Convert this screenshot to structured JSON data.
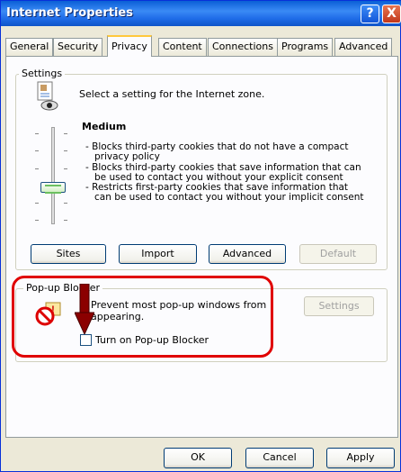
{
  "window": {
    "title": "Internet Properties"
  },
  "title_buttons": {
    "help": "?",
    "close": "X"
  },
  "tabs": [
    "General",
    "Security",
    "Privacy",
    "Content",
    "Connections",
    "Programs",
    "Advanced"
  ],
  "active_tab": "Privacy",
  "settings": {
    "group_label": "Settings",
    "zone_text": "Select a setting for the Internet zone.",
    "level": "Medium",
    "descriptions": [
      "- Blocks third-party cookies that do not have a compact",
      "privacy policy",
      "- Blocks third-party cookies that save information that can",
      "be used to contact you without your explicit consent",
      "- Restricts first-party cookies that save information that",
      "can be used to contact you without your implicit consent"
    ],
    "buttons": {
      "sites": "Sites",
      "import": "Import",
      "advanced": "Advanced",
      "default": "Default"
    }
  },
  "popup_blocker": {
    "group_label": "Pop-up Blocker",
    "text": "Prevent most pop-up windows from appearing.",
    "settings_button": "Settings",
    "checkbox_label": "Turn on Pop-up Blocker",
    "checked": false
  },
  "footer": {
    "ok": "OK",
    "cancel": "Cancel",
    "apply": "Apply"
  },
  "colors": {
    "title_bar": "#1f6ce8",
    "highlight": "#e00000",
    "arrow": "#8b0000",
    "tab_accent": "#ffc83c"
  }
}
